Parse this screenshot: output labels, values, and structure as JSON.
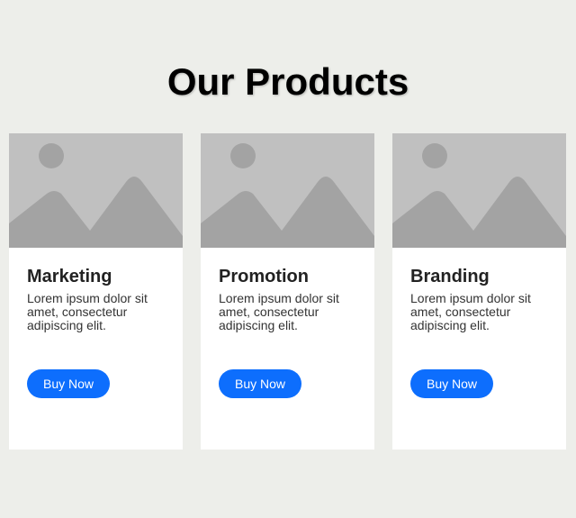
{
  "header": {
    "title": "Our Products"
  },
  "colors": {
    "background": "#edeeea",
    "card": "#ffffff",
    "button": "#0d6efd",
    "placeholder_bg": "#c0c0c0",
    "placeholder_shape": "#a3a3a3"
  },
  "products": [
    {
      "image_icon": "image-placeholder-icon",
      "title": "Marketing",
      "description": "Lorem ipsum dolor sit amet, consectetur adipiscing elit.",
      "button_label": "Buy Now"
    },
    {
      "image_icon": "image-placeholder-icon",
      "title": "Promotion",
      "description": "Lorem ipsum dolor sit amet, consectetur adipiscing elit.",
      "button_label": "Buy Now"
    },
    {
      "image_icon": "image-placeholder-icon",
      "title": "Branding",
      "description": "Lorem ipsum dolor sit amet, consectetur adipiscing elit.",
      "button_label": "Buy Now"
    }
  ]
}
